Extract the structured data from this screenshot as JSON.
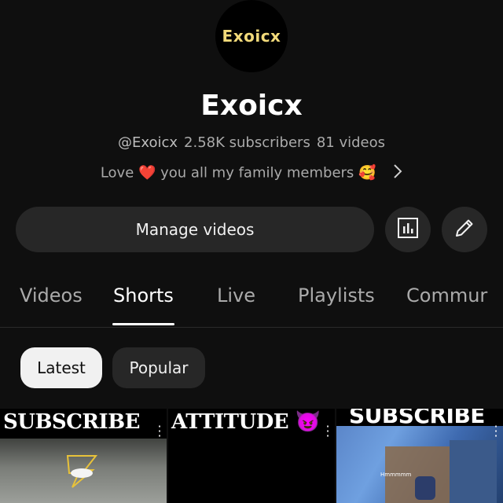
{
  "channel": {
    "avatar_text": "Exoicx",
    "name": "Exoicx",
    "handle": "@Exoicx",
    "subscribers": "2.58K subscribers",
    "videos": "81 videos",
    "description": "Love ❤️ you all my family members 🥰"
  },
  "actions": {
    "manage_label": "Manage videos",
    "analytics_icon": "analytics-icon",
    "edit_icon": "edit-pencil-icon"
  },
  "tabs": [
    {
      "label": "Videos",
      "active": false
    },
    {
      "label": "Shorts",
      "active": true
    },
    {
      "label": "Live",
      "active": false
    },
    {
      "label": "Playlists",
      "active": false
    },
    {
      "label": "Commur",
      "active": false
    }
  ],
  "filters": [
    {
      "label": "Latest",
      "selected": true
    },
    {
      "label": "Popular",
      "selected": false
    }
  ],
  "shorts": [
    {
      "caption": "SUBSCRIBE"
    },
    {
      "caption": "ATTITUDE 😈"
    },
    {
      "caption": "SUBSCRIBE",
      "overlay_tag": "Hmmmmm"
    }
  ],
  "colors": {
    "background": "#0f0f0f",
    "button": "#272727",
    "chip_selected": "#f1f1f1",
    "avatar_text": "#f2da7a"
  }
}
